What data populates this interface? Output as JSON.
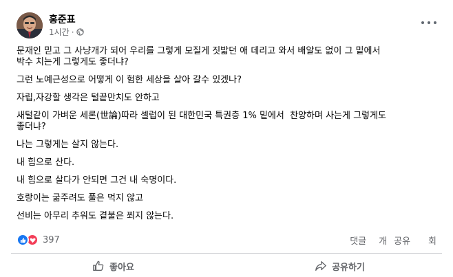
{
  "post": {
    "author": "홍준표",
    "time": "1시간",
    "paragraphs": [
      "문재인 믿고 그 사냥개가 되어 우리를 그렇게 모질게 짓밟던 애 데리고 와서 배알도 없이 그 밑에서\n박수 치는게 그렇게도 좋더냐?",
      "그런 노예근성으로 어떻게 이 험한 세상을 살아 갈수 있겠나?",
      "자립,자강할 생각은 털끝만치도 안하고",
      "새털같이 가벼운 세론(世論)따라 셀럽이 된 대한민국 특권층 1% 밑에서  찬양하며 사는게 그렇게도\n좋더냐?",
      "나는 그렇게는 살지 않는다.",
      "내 힘으로 산다.",
      "내 힘으로 살다가 안되면 그건 내 숙명이다.",
      "호랑이는 굶주려도 풀은 먹지 않고",
      "선비는 아무리 추워도 곁불은 쬐지 않는다."
    ]
  },
  "stats": {
    "reaction_count": "397",
    "comments_label": "댓글",
    "count_unit": "개",
    "shares_label": "공유",
    "shares_unit": "회"
  },
  "actions": {
    "like_label": "좋아요",
    "share_label": "공유하기"
  },
  "icons": {
    "globe": "globe-icon",
    "more": "more-options-icon",
    "like": "thumbs-up-icon",
    "love": "heart-icon",
    "share": "share-arrow-icon"
  },
  "colors": {
    "like_blue": "#1877f2",
    "love_red": "#f33e58",
    "secondary_text": "#65676b"
  }
}
